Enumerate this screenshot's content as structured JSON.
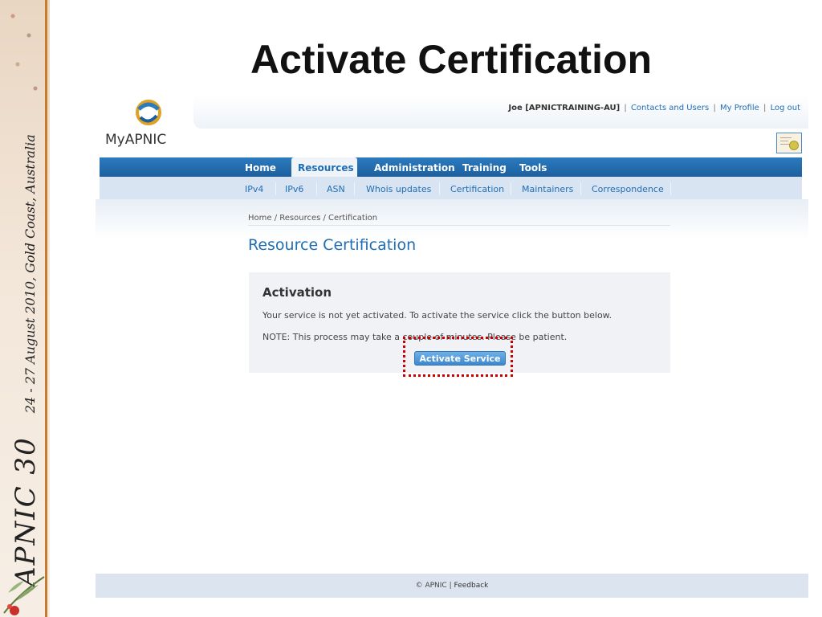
{
  "slide": {
    "title": "Activate Certification",
    "conference": "APNIC 30",
    "dates": "24 - 27 August 2010, Gold Coast, Australia"
  },
  "app": {
    "logo_text": "MyAPNIC"
  },
  "userbar": {
    "user": "Joe [APNICTRAINING-AU]",
    "sep": "|",
    "links": [
      "Contacts and Users",
      "My Profile",
      "Log out"
    ]
  },
  "main_nav": {
    "tabs": [
      "Home",
      "Resources",
      "Administration",
      "Training",
      "Tools"
    ],
    "active": "Resources"
  },
  "sub_nav": {
    "items": [
      "IPv4",
      "IPv6",
      "ASN",
      "Whois updates",
      "Certification",
      "Maintainers",
      "Correspondence"
    ]
  },
  "breadcrumb": "Home / Resources / Certification",
  "page_title": "Resource Certification",
  "panel": {
    "heading": "Activation",
    "text1": "Your service is not yet activated. To activate the service click the button below.",
    "text2": "NOTE: This process may take a couple of minutes. Please be patient.",
    "button_label": "Activate Service"
  },
  "footer": {
    "copyright": "© APNIC",
    "sep": "|",
    "feedback": "Feedback"
  },
  "colors": {
    "nav_blue": "#1e5f9d",
    "link_blue": "#1f6eb5",
    "highlight_red": "#cc0000",
    "strip_orange": "#c97b2c"
  }
}
